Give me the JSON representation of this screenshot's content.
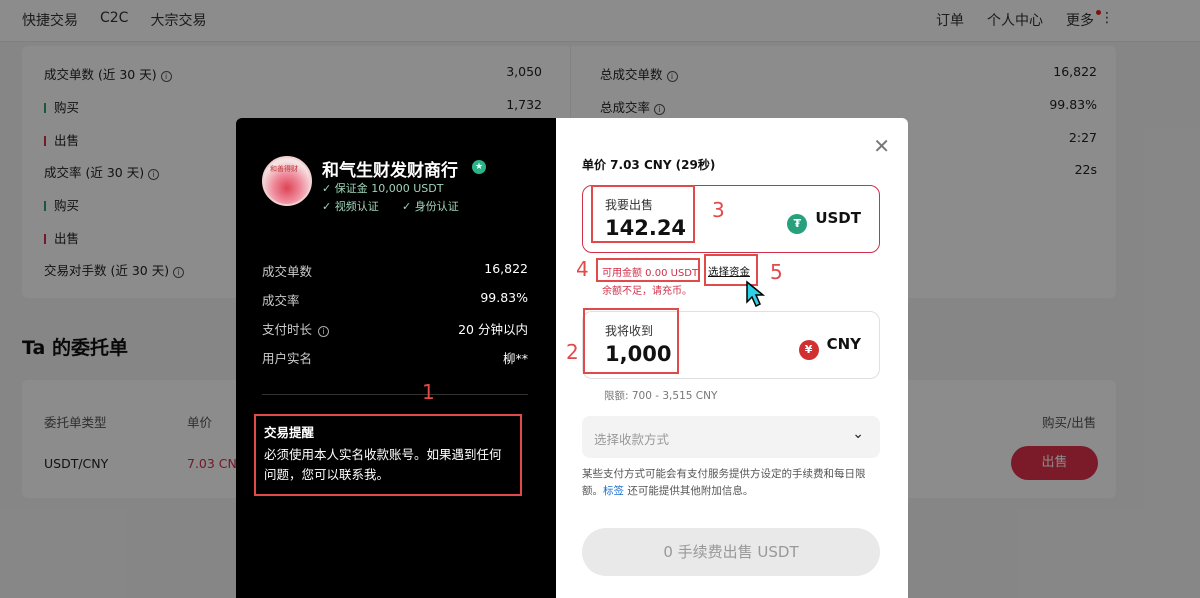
{
  "nav": {
    "left": [
      "快捷交易",
      "C2C",
      "大宗交易"
    ],
    "right": [
      "订单",
      "个人中心",
      "更多"
    ]
  },
  "stats": {
    "left": [
      {
        "label": "成交单数 (近 30 天)",
        "value": "3,050",
        "info": true
      },
      {
        "label": "购买",
        "value": "1,732",
        "bar": "green"
      },
      {
        "label": "出售",
        "value": "",
        "bar": "red"
      },
      {
        "label": "成交率 (近 30 天)",
        "value": "",
        "info": true
      },
      {
        "label": "购买",
        "value": "",
        "bar": "green"
      },
      {
        "label": "出售",
        "value": "",
        "bar": "red"
      },
      {
        "label": "交易对手数 (近 30 天)",
        "value": "",
        "info": true
      }
    ],
    "right": [
      {
        "label": "总成交单数",
        "value": "16,822",
        "info": true
      },
      {
        "label": "总成交率",
        "value": "99.83%",
        "info": true
      },
      {
        "label": "",
        "value": "2:27"
      },
      {
        "label": "",
        "value": "22s"
      }
    ]
  },
  "orders": {
    "title": "Ta 的委托单",
    "headers": [
      "委托单类型",
      "单价",
      "购买/出售"
    ],
    "row": {
      "pair": "USDT/CNY",
      "price": "7.03 CN",
      "action": "出售"
    }
  },
  "merchant": {
    "name": "和气生财发财商行",
    "deposit": "✓ 保证金 10,000 USDT",
    "verify_video": "✓ 视频认证",
    "verify_id": "✓ 身份认证",
    "avatar_text": "和善得财",
    "stats": [
      {
        "label": "成交单数",
        "value": "16,822"
      },
      {
        "label": "成交率",
        "value": "99.83%"
      },
      {
        "label": "支付时长",
        "value": "20 分钟以内",
        "info": true
      },
      {
        "label": "用户实名",
        "value": "柳**"
      }
    ],
    "tip_title": "交易提醒",
    "tip_body": "必须使用本人实名收款账号。如果遇到任何问题，您可以联系我。"
  },
  "trade": {
    "price_line": "单价 7.03 CNY (29秒)",
    "sell_label": "我要出售",
    "sell_value": "142.24",
    "sell_currency": "USDT",
    "available": "可用金额 0.00 USDT",
    "select_funds": "选择资金",
    "insufficient": "余额不足，请充币。",
    "receive_label": "我将收到",
    "receive_value": "1,000",
    "receive_currency": "CNY",
    "limit": "限额: 700 - 3,515 CNY",
    "payment_placeholder": "选择收款方式",
    "note_before": "某些支付方式可能会有支付服务提供方设定的手续费和每日限额。",
    "note_link": "标签",
    "note_after": " 还可能提供其他附加信息。",
    "submit": "0 手续费出售 USDT"
  },
  "annotations": [
    "1",
    "2",
    "3",
    "4",
    "5"
  ],
  "colors": {
    "accent_red": "#e14a4a",
    "sell_red": "#e0304a",
    "usdt_green": "#26a17b",
    "cny_red": "#d03030"
  }
}
